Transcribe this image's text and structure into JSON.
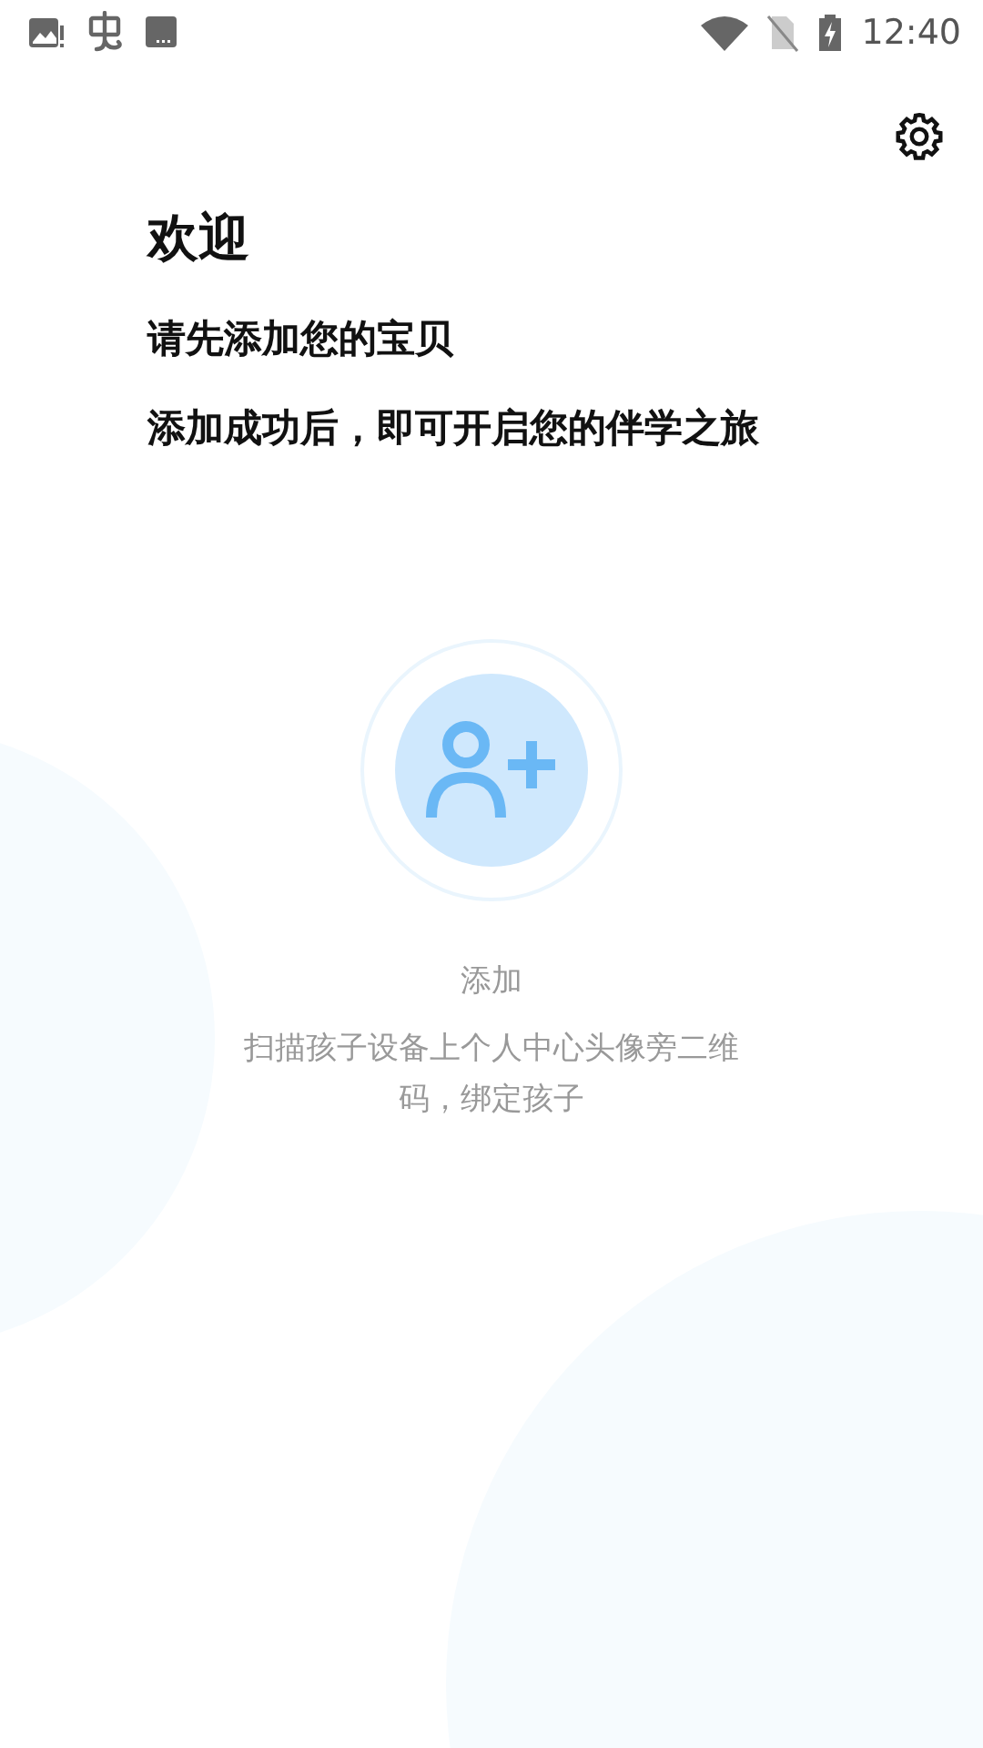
{
  "status_bar": {
    "time": "12:40"
  },
  "header": {
    "title": "欢迎",
    "lines": [
      "请先添加您的宝贝",
      "添加成功后，即可开启您的伴学之旅"
    ]
  },
  "add": {
    "label": "添加",
    "description": "扫描孩子设备上个人中心头像旁二维码，绑定孩子"
  }
}
